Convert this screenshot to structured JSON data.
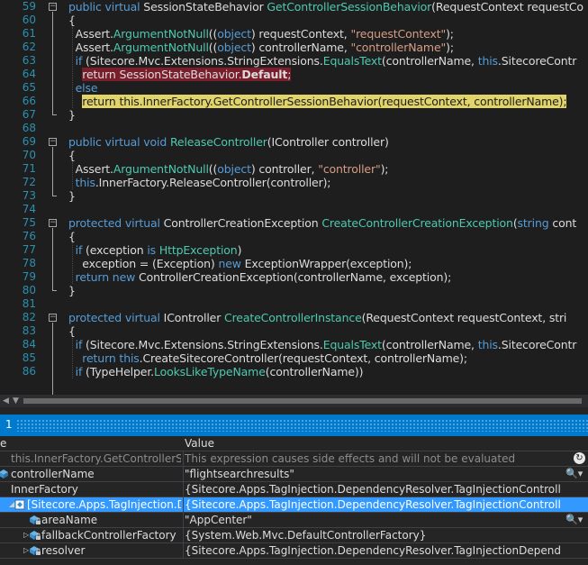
{
  "editor": {
    "lines": [
      {
        "n": "59",
        "t": [
          {
            "c": "kw",
            "s": "public virtual "
          },
          {
            "c": "",
            "s": "SessionStateBehavior "
          },
          {
            "c": "ty",
            "s": "GetControllerSessionBehavior"
          },
          {
            "c": "",
            "s": "(RequestContext requestCo"
          }
        ]
      },
      {
        "n": "60",
        "t": [
          {
            "c": "",
            "s": "{"
          }
        ]
      },
      {
        "n": "61",
        "t": [
          {
            "c": "",
            "s": "  Assert."
          },
          {
            "c": "ty",
            "s": "ArgumentNotNull"
          },
          {
            "c": "",
            "s": "(("
          },
          {
            "c": "kw",
            "s": "object"
          },
          {
            "c": "",
            "s": ") requestContext, "
          },
          {
            "c": "str",
            "s": "\"requestContext\""
          },
          {
            "c": "",
            "s": ");"
          }
        ]
      },
      {
        "n": "62",
        "t": [
          {
            "c": "",
            "s": "  Assert."
          },
          {
            "c": "ty",
            "s": "ArgumentNotNull"
          },
          {
            "c": "",
            "s": "(("
          },
          {
            "c": "kw",
            "s": "object"
          },
          {
            "c": "",
            "s": ") controllerName, "
          },
          {
            "c": "str",
            "s": "\"controllerName\""
          },
          {
            "c": "",
            "s": ");"
          }
        ]
      },
      {
        "n": "63",
        "t": [
          {
            "c": "kw",
            "s": "  if "
          },
          {
            "c": "",
            "s": "(Sitecore.Mvc.Extensions.StringExtensions."
          },
          {
            "c": "ty",
            "s": "EqualsText"
          },
          {
            "c": "",
            "s": "(controllerName, "
          },
          {
            "c": "kw",
            "s": "this"
          },
          {
            "c": "",
            "s": ".SitecoreContr"
          }
        ]
      },
      {
        "n": "64",
        "t": [
          {
            "c": "",
            "s": "    "
          },
          {
            "c": "hl-red",
            "s": "return SessionStateBehavior."
          },
          {
            "c": "hl-red bold",
            "s": "Default"
          },
          {
            "c": "hl-red",
            "s": ";"
          }
        ]
      },
      {
        "n": "65",
        "t": [
          {
            "c": "kw",
            "s": "  else"
          }
        ]
      },
      {
        "n": "66",
        "t": [
          {
            "c": "",
            "s": "    "
          },
          {
            "c": "hl-yel",
            "s": "return this.InnerFactory.GetControllerSessionBehavior(requestContext, controllerName);"
          }
        ]
      },
      {
        "n": "67",
        "t": [
          {
            "c": "",
            "s": "}"
          }
        ]
      },
      {
        "n": "68",
        "t": []
      },
      {
        "n": "69",
        "t": [
          {
            "c": "kw",
            "s": "public virtual void "
          },
          {
            "c": "ty",
            "s": "ReleaseController"
          },
          {
            "c": "",
            "s": "(IController controller)"
          }
        ]
      },
      {
        "n": "70",
        "t": [
          {
            "c": "",
            "s": "{"
          }
        ]
      },
      {
        "n": "71",
        "t": [
          {
            "c": "",
            "s": "  Assert."
          },
          {
            "c": "ty",
            "s": "ArgumentNotNull"
          },
          {
            "c": "",
            "s": "(("
          },
          {
            "c": "kw",
            "s": "object"
          },
          {
            "c": "",
            "s": ") controller, "
          },
          {
            "c": "str",
            "s": "\"controller\""
          },
          {
            "c": "",
            "s": ");"
          }
        ]
      },
      {
        "n": "72",
        "t": [
          {
            "c": "kw",
            "s": "  this"
          },
          {
            "c": "",
            "s": ".InnerFactory.ReleaseController(controller);"
          }
        ]
      },
      {
        "n": "73",
        "t": [
          {
            "c": "",
            "s": "}"
          }
        ]
      },
      {
        "n": "74",
        "t": []
      },
      {
        "n": "75",
        "t": [
          {
            "c": "kw",
            "s": "protected virtual "
          },
          {
            "c": "",
            "s": "ControllerCreationException "
          },
          {
            "c": "ty",
            "s": "CreateControllerCreationException"
          },
          {
            "c": "",
            "s": "("
          },
          {
            "c": "kw",
            "s": "string "
          },
          {
            "c": "",
            "s": "cont"
          }
        ]
      },
      {
        "n": "76",
        "t": [
          {
            "c": "",
            "s": "{"
          }
        ]
      },
      {
        "n": "77",
        "t": [
          {
            "c": "kw",
            "s": "  if "
          },
          {
            "c": "",
            "s": "(exception "
          },
          {
            "c": "kw",
            "s": "is "
          },
          {
            "c": "ty",
            "s": "HttpException"
          },
          {
            "c": "",
            "s": ")"
          }
        ]
      },
      {
        "n": "78",
        "t": [
          {
            "c": "",
            "s": "    exception = (Exception) "
          },
          {
            "c": "kw",
            "s": "new "
          },
          {
            "c": "",
            "s": "ExceptionWrapper(exception);"
          }
        ]
      },
      {
        "n": "79",
        "t": [
          {
            "c": "kw",
            "s": "  return new "
          },
          {
            "c": "",
            "s": "ControllerCreationException(controllerName, exception);"
          }
        ]
      },
      {
        "n": "80",
        "t": [
          {
            "c": "",
            "s": "}"
          }
        ]
      },
      {
        "n": "81",
        "t": []
      },
      {
        "n": "82",
        "t": [
          {
            "c": "kw",
            "s": "protected virtual "
          },
          {
            "c": "",
            "s": "IController "
          },
          {
            "c": "ty",
            "s": "CreateControllerInstance"
          },
          {
            "c": "",
            "s": "(RequestContext requestContext, stri"
          }
        ]
      },
      {
        "n": "83",
        "t": [
          {
            "c": "",
            "s": "{"
          }
        ]
      },
      {
        "n": "84",
        "t": [
          {
            "c": "kw",
            "s": "  if "
          },
          {
            "c": "",
            "s": "(Sitecore.Mvc.Extensions.StringExtensions."
          },
          {
            "c": "ty",
            "s": "EqualsText"
          },
          {
            "c": "",
            "s": "(controllerName, "
          },
          {
            "c": "kw",
            "s": "this"
          },
          {
            "c": "",
            "s": ".SitecoreContr"
          }
        ]
      },
      {
        "n": "85",
        "t": [
          {
            "c": "kw",
            "s": "    return this"
          },
          {
            "c": "",
            "s": ".CreateSitecoreController(requestContext, controllerName);"
          }
        ]
      },
      {
        "n": "86",
        "t": [
          {
            "c": "kw",
            "s": "  if "
          },
          {
            "c": "",
            "s": "(TypeHelper."
          },
          {
            "c": "ty",
            "s": "LooksLikeTypeName"
          },
          {
            "c": "",
            "s": "(controllerName))"
          }
        ]
      }
    ]
  },
  "panel": {
    "tab_number": "1",
    "col_name": "e",
    "col_value": "Value",
    "rows": [
      {
        "name": "this.InnerFactory.GetControllerSessi",
        "value": "This expression causes side effects and will not be evaluated",
        "style": "dim",
        "icon": "none",
        "expander": "",
        "indent": 12,
        "action": "refresh"
      },
      {
        "name": "controllerName",
        "value": "\"flightsearchresults\"",
        "style": "",
        "icon": "field",
        "expander": "",
        "indent": 12,
        "action": "magnifier"
      },
      {
        "name": "InnerFactory",
        "value": "{Sitecore.Apps.TagInjection.DependencyResolver.TagInjectionControllerFactory}",
        "style": "",
        "icon": "none",
        "expander": "",
        "indent": 12,
        "action": ""
      },
      {
        "name": "[Sitecore.Apps.TagInjection.Dep",
        "value": "{Sitecore.Apps.TagInjection.DependencyResolver.TagInjectionControllerFactory}",
        "style": "sel",
        "icon": "object",
        "expander": "◢",
        "indent": 30,
        "action": ""
      },
      {
        "name": "areaName",
        "value": "\"AppCenter\"",
        "style": "",
        "icon": "field-lock",
        "expander": "",
        "indent": 46,
        "action": "magnifier"
      },
      {
        "name": "fallbackControllerFactory",
        "value": "{System.Web.Mvc.DefaultControllerFactory}",
        "style": "",
        "icon": "field-lock",
        "expander": "▷",
        "indent": 46,
        "action": ""
      },
      {
        "name": "resolver",
        "value": "{Sitecore.Apps.TagInjection.DependencyResolver.TagInjectionDependencyResolver}",
        "style": "",
        "icon": "field-lock",
        "expander": "▷",
        "indent": 46,
        "action": ""
      }
    ],
    "magnifier_glyph": "🔍▾",
    "refresh_glyph": "↻"
  },
  "colors": {
    "background": "#1e1e1e",
    "keyword": "#569cd6",
    "type": "#4ec9b0",
    "string": "#d69d85",
    "line_number": "#2b91af",
    "breakpoint_line": "#7a1e2c",
    "current_line": "#e1d46b",
    "panel_header": "#007acc",
    "selection": "#3399ff"
  }
}
